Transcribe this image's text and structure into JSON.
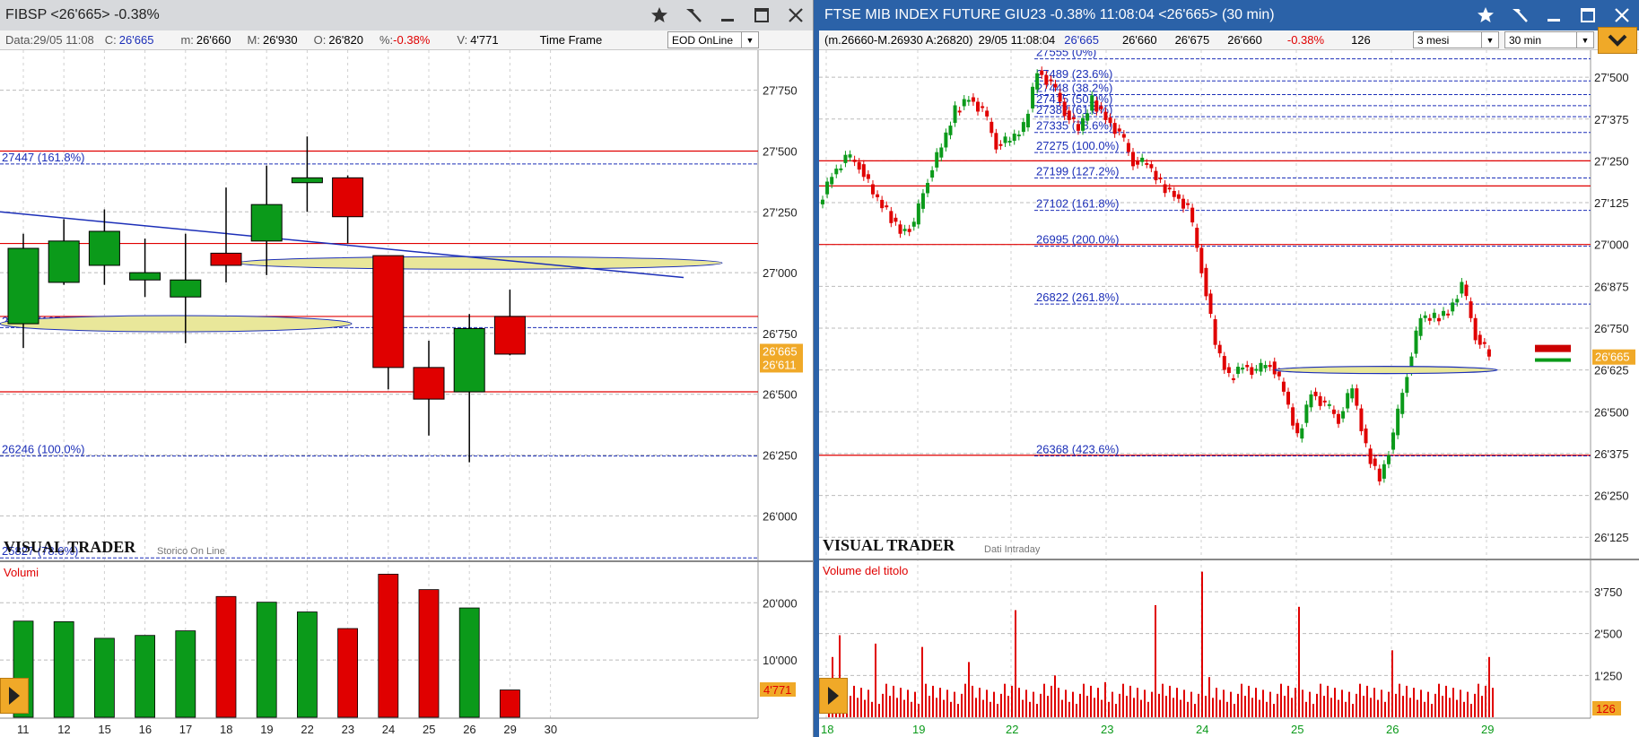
{
  "left": {
    "title": "FIBSP <26'665> -0.38%",
    "info": {
      "data_label": "Data:",
      "data_value": "29/05 11:08",
      "c_label": "C:",
      "c_value": "26'665",
      "m_label": "m:",
      "m_value": "26'660",
      "M_label": "M:",
      "M_value": "26'930",
      "o_label": "O:",
      "o_value": "26'820",
      "pct_label": "%:",
      "pct_value": "-0.38%",
      "v_label": "V:",
      "v_value": "4'771",
      "timeframe_label": "Time Frame",
      "timeframe_value": "EOD OnLine"
    },
    "brand": "VISUAL TRADER",
    "brand_sub": "Storico On Line",
    "volume_label": "Volumi",
    "price_badge_1": "26'665",
    "price_badge_2": "26'611",
    "volume_badge": "4'771"
  },
  "right": {
    "title": "FTSE MIB INDEX FUTURE GIU23 -0.38% 11:08:04 <26'665> (30 min)",
    "info": {
      "range": "(m.26660-M.26930 A:26820)",
      "time": "29/05 11:08:04",
      "v1": "26'665",
      "v2": "26'660",
      "v3": "26'675",
      "v4": "26'660",
      "pct": "-0.38%",
      "count": "126",
      "period_select": "3 mesi",
      "interval_select": "30 min"
    },
    "brand": "VISUAL TRADER",
    "brand_sub": "Dati Intraday",
    "volume_label": "Volume del titolo",
    "price_badge": "26'665",
    "volume_badge": "126"
  },
  "colors": {
    "up": "#0b9a1a",
    "down": "#e00000",
    "blue_line": "#1c2fb8",
    "badge": "#f0a928",
    "titlebar_active": "#2b62a8"
  },
  "chart_data": [
    {
      "type": "candlestick",
      "title": "FIBSP <26'665> -0.38%",
      "categories": [
        "11",
        "12",
        "15",
        "16",
        "17",
        "18",
        "19",
        "22",
        "23",
        "24",
        "25",
        "26",
        "29",
        "30"
      ],
      "ohlc": [
        {
          "o": 26790,
          "h": 27160,
          "l": 26690,
          "c": 27100
        },
        {
          "o": 26960,
          "h": 27220,
          "l": 26950,
          "c": 27130
        },
        {
          "o": 27030,
          "h": 27260,
          "l": 26950,
          "c": 27170
        },
        {
          "o": 26970,
          "h": 27140,
          "l": 26900,
          "c": 27000
        },
        {
          "o": 26900,
          "h": 27160,
          "l": 26710,
          "c": 26970
        },
        {
          "o": 27080,
          "h": 27350,
          "l": 26960,
          "c": 27030
        },
        {
          "o": 27130,
          "h": 27440,
          "l": 26990,
          "c": 27280
        },
        {
          "o": 27370,
          "h": 27560,
          "l": 27250,
          "c": 27390
        },
        {
          "o": 27390,
          "h": 27400,
          "l": 27120,
          "c": 27230
        },
        {
          "o": 27070,
          "h": 27070,
          "l": 26520,
          "c": 26610
        },
        {
          "o": 26610,
          "h": 26720,
          "l": 26330,
          "c": 26480
        },
        {
          "o": 26510,
          "h": 26830,
          "l": 26220,
          "c": 26770
        },
        {
          "o": 26820,
          "h": 26930,
          "l": 26660,
          "c": 26665
        }
      ],
      "volumes": [
        16800,
        16700,
        13800,
        14300,
        15100,
        21100,
        20100,
        18400,
        15500,
        25000,
        22300,
        19100,
        4771
      ],
      "y_ticks": [
        "26'000",
        "26'250",
        "26'500",
        "26'750",
        "27'000",
        "27'250",
        "27'500",
        "27'750"
      ],
      "ylim": [
        25850,
        27900
      ],
      "volume_ticks": [
        "10'000",
        "20'000"
      ],
      "fib_levels": [
        {
          "value": 27447,
          "label": "27447 (161.8%)"
        },
        {
          "value": 26774,
          "label": "26774 (127.2%)"
        },
        {
          "value": 26246,
          "label": "26246 (100.0%)"
        },
        {
          "value": 25827,
          "label": "25827 (78.6%)"
        }
      ],
      "red_lines": [
        27500,
        27120,
        26820,
        26510
      ]
    },
    {
      "type": "candlestick",
      "title": "FTSE MIB INDEX FUTURE GIU23 (30 min)",
      "x_ticks": [
        "18",
        "19",
        "22",
        "23",
        "24",
        "25",
        "26",
        "29"
      ],
      "y_ticks": [
        "26'125",
        "26'250",
        "26'375",
        "26'500",
        "26'625",
        "26'750",
        "26'875",
        "27'000",
        "27'125",
        "27'250",
        "27'375",
        "27'500"
      ],
      "ylim": [
        26080,
        27570
      ],
      "close_path": [
        27120,
        27210,
        27260,
        27240,
        27150,
        27100,
        27040,
        27060,
        27200,
        27290,
        27400,
        27440,
        27400,
        27300,
        27310,
        27350,
        27520,
        27480,
        27400,
        27340,
        27430,
        27380,
        27330,
        27250,
        27240,
        27180,
        27150,
        27110,
        26930,
        26700,
        26600,
        26640,
        26620,
        26650,
        26560,
        26420,
        26560,
        26520,
        26480,
        26570,
        26390,
        26300,
        26430,
        26620,
        26780,
        26780,
        26800,
        26880,
        26730,
        26665
      ],
      "volume_ticks": [
        "1'250",
        "2'500",
        "3'750"
      ],
      "fib_levels": [
        {
          "value": 27555,
          "label": "27555 (0%)"
        },
        {
          "value": 27489,
          "label": "27489 (23.6%)"
        },
        {
          "value": 27448,
          "label": "27448 (38.2%)"
        },
        {
          "value": 27415,
          "label": "27415 (50.0%)"
        },
        {
          "value": 27382,
          "label": "27382 (61.8%)"
        },
        {
          "value": 27335,
          "label": "27335 (78.6%)"
        },
        {
          "value": 27275,
          "label": "27275 (100.0%)"
        },
        {
          "value": 27199,
          "label": "27199 (127.2%)"
        },
        {
          "value": 27102,
          "label": "27102 (161.8%)"
        },
        {
          "value": 26995,
          "label": "26995 (200.0%)"
        },
        {
          "value": 26822,
          "label": "26822 (261.8%)"
        },
        {
          "value": 26368,
          "label": "26368 (423.6%)"
        }
      ]
    }
  ]
}
